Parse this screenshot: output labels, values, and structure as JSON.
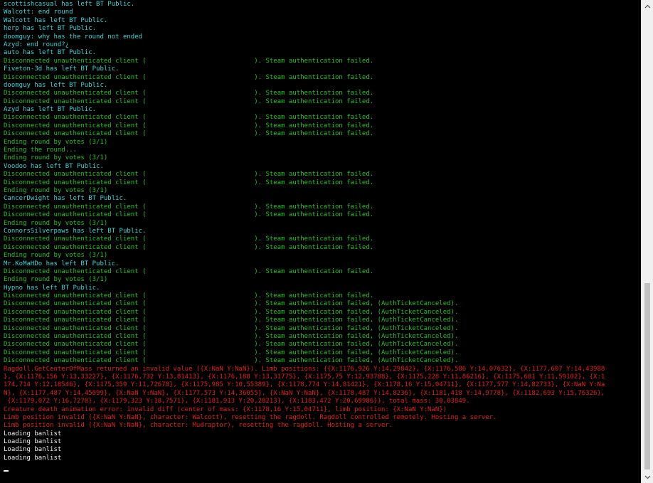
{
  "console": {
    "lines": [
      {
        "text": "scottishcasual has left BT Public.",
        "color": "cyan"
      },
      {
        "text": "Walcott: end round",
        "color": "cyan"
      },
      {
        "text": "Walcott has left BT Public.",
        "color": "cyan"
      },
      {
        "text": "herp has left BT Public.",
        "color": "cyan"
      },
      {
        "text": "doomguy: why has the round not ended",
        "color": "cyan"
      },
      {
        "text": "Azyd: end round?¿",
        "color": "cyan"
      },
      {
        "text": "auto has left BT Public.",
        "color": "cyan"
      },
      {
        "text": "Disconnected unauthenticated client (                            ). Steam authentication failed.",
        "color": "green"
      },
      {
        "text": "Fiveton-3d has left BT Public.",
        "color": "cyan"
      },
      {
        "text": "Disconnected unauthenticated client (                            ). Steam authentication failed.",
        "color": "green"
      },
      {
        "text": "doomguy has left BT Public.",
        "color": "cyan"
      },
      {
        "text": "Disconnected unauthenticated client (                            ). Steam authentication failed.",
        "color": "green"
      },
      {
        "text": "Disconnected unauthenticated client (                            ). Steam authentication failed.",
        "color": "green"
      },
      {
        "text": "Azyd has left BT Public.",
        "color": "cyan"
      },
      {
        "text": "Disconnected unauthenticated client (                            ). Steam authentication failed.",
        "color": "green"
      },
      {
        "text": "Disconnected unauthenticated client (                            ). Steam authentication failed.",
        "color": "green"
      },
      {
        "text": "Disconnected unauthenticated client (                            ). Steam authentication failed.",
        "color": "green"
      },
      {
        "text": "Ending round by votes (3/1)",
        "color": "green"
      },
      {
        "text": "Ending the round...",
        "color": "green"
      },
      {
        "text": "Ending round by votes (3/1)",
        "color": "green"
      },
      {
        "text": "Voodoo has left BT Public.",
        "color": "cyan"
      },
      {
        "text": "Disconnected unauthenticated client (                            ). Steam authentication failed.",
        "color": "green"
      },
      {
        "text": "Disconnected unauthenticated client (                            ). Steam authentication failed.",
        "color": "green"
      },
      {
        "text": "Ending round by votes (3/1)",
        "color": "green"
      },
      {
        "text": "CancerDwight has left BT Public.",
        "color": "cyan"
      },
      {
        "text": "Disconnected unauthenticated client (                            ). Steam authentication failed.",
        "color": "green"
      },
      {
        "text": "Disconnected unauthenticated client (                            ). Steam authentication failed.",
        "color": "green"
      },
      {
        "text": "Ending round by votes (3/1)",
        "color": "green"
      },
      {
        "text": "ConnorsSilverpaws has left BT Public.",
        "color": "cyan"
      },
      {
        "text": "Disconnected unauthenticated client (                            ). Steam authentication failed.",
        "color": "green"
      },
      {
        "text": "Disconnected unauthenticated client (                            ). Steam authentication failed.",
        "color": "green"
      },
      {
        "text": "Ending round by votes (3/1)",
        "color": "green"
      },
      {
        "text": "Mr.KoMaHDo has left BT Public.",
        "color": "cyan"
      },
      {
        "text": "Disconnected unauthenticated client (                            ). Steam authentication failed.",
        "color": "green"
      },
      {
        "text": "Ending round by votes (3/1)",
        "color": "green"
      },
      {
        "text": "Hypno has left BT Public.",
        "color": "cyan"
      },
      {
        "text": "Disconnected unauthenticated client (                            ). Steam authentication failed.",
        "color": "green"
      },
      {
        "text": "Disconnected unauthenticated client (                            ). Steam authentication failed, (AuthTicketCanceled).",
        "color": "green"
      },
      {
        "text": "Disconnected unauthenticated client (                            ). Steam authentication failed, (AuthTicketCanceled).",
        "color": "green"
      },
      {
        "text": "Disconnected unauthenticated client (                            ). Steam authentication failed, (AuthTicketCanceled).",
        "color": "green"
      },
      {
        "text": "Disconnected unauthenticated client (                            ). Steam authentication failed, (AuthTicketCanceled).",
        "color": "green"
      },
      {
        "text": "Disconnected unauthenticated client (                            ). Steam authentication failed, (AuthTicketCanceled).",
        "color": "green"
      },
      {
        "text": "Disconnected unauthenticated client (                            ). Steam authentication failed, (AuthTicketCanceled).",
        "color": "green"
      },
      {
        "text": "Disconnected unauthenticated client (                            ). Steam authentication failed, (AuthTicketCanceled).",
        "color": "green"
      },
      {
        "text": "Disconnected unauthenticated client (                            ). Steam authentication failed, (AuthTicketCanceled).",
        "color": "green"
      },
      {
        "text": "Ragdoll.GetCenterOfMass returned an invalid value ({X:NaN Y:NaN}). Limb positions: {{X:1176,926 Y:14,29842}, {X:1176,586 Y:14,07632}, {X:1177,607 Y:14,43988",
        "color": "red"
      },
      {
        "text": "}, {X:1176,156 Y:13,33227}, {X:1176,732 Y:13,81413}, {X:1176,188 Y:13,31775}, {X:1175,75 Y:12,93788}, {X:1175,228 Y:11,86216}, {X:1175,681 Y:11,59102}, {X:1",
        "color": "red"
      },
      {
        "text": "174,714 Y:12,18546}, {X:1175,359 Y:11,72678}, {X:1175,985 Y:10,55389}, {X:1178,774 Y:14,81421}, {X:1178,16 Y:15,04711}, {X:1177,577 Y:14,82733}, {X:NaN Y:Na",
        "color": "red"
      },
      {
        "text": "N}, {X:1177,487 Y:14,45099}, {X:NaN Y:NaN}, {X:1177,573 Y:14,36055}, {X:NaN Y:NaN}, {X:1178,487 Y:14,8236}, {X:1181,418 Y:14,9778}, {X:1182,693 Y:15,76326},",
        "color": "red"
      },
      {
        "text": " {X:1179,072 Y:16,7278}, {X:1179,323 Y:18,7571}, {X:1181,913 Y:20,28213}, {X:1183,472 Y:20,69986}}, total mass: 30,03849.",
        "color": "red"
      },
      {
        "text": "Creature death animation error: invalid diff (center of mass: {X:1178,16 Y:15,04711}, limb position: {X:NaN Y:NaN})",
        "color": "red"
      },
      {
        "text": "Limb position invalid ({X:NaN Y:NaN}, character: Walcott), resetting the ragdoll. Ragdoll controlled remotely. Hosting a server.",
        "color": "red"
      },
      {
        "text": "Limb position invalid ({X:NaN Y:NaN}, character: Mudraptor), resetting the ragdoll. Hosting a server.",
        "color": "red"
      },
      {
        "text": "Loading banlist",
        "color": "white"
      },
      {
        "text": "Loading banlist",
        "color": "white"
      },
      {
        "text": "Loading banlist",
        "color": "white"
      },
      {
        "text": "Loading banlist",
        "color": "white"
      }
    ]
  },
  "scrollbar": {
    "up_icon": "chevron-up-icon",
    "down_icon": "chevron-down-icon"
  }
}
